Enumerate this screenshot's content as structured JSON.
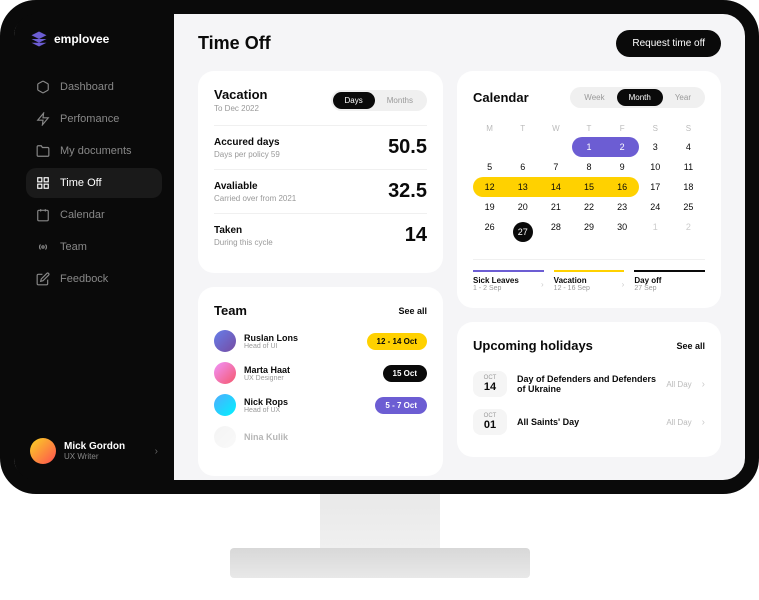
{
  "brand": {
    "name": "emplovee"
  },
  "nav": {
    "items": [
      {
        "label": "Dashboard"
      },
      {
        "label": "Perfomance"
      },
      {
        "label": "My documents"
      },
      {
        "label": "Time Off"
      },
      {
        "label": "Calendar"
      },
      {
        "label": "Team"
      },
      {
        "label": "Feedbock"
      }
    ]
  },
  "user": {
    "name": "Mick Gordon",
    "role": "UX Writer"
  },
  "page": {
    "title": "Time Off",
    "cta": "Request time off"
  },
  "vacation": {
    "title": "Vacation",
    "subtitle": "To Dec 2022",
    "tabs": {
      "days": "Days",
      "months": "Months"
    },
    "stats": [
      {
        "label": "Accured days",
        "sub": "Days per policy 59",
        "value": "50.5"
      },
      {
        "label": "Avaliable",
        "sub": "Carried over from 2021",
        "value": "32.5"
      },
      {
        "label": "Taken",
        "sub": "During this cycle",
        "value": "14"
      }
    ]
  },
  "team": {
    "title": "Team",
    "see_all": "See all",
    "members": [
      {
        "name": "Ruslan Lons",
        "role": "Head of UI",
        "badge": "12 - 14 Oct",
        "badge_style": "yellow"
      },
      {
        "name": "Marta Haat",
        "role": "UX Designer",
        "badge": "15 Oct",
        "badge_style": "black"
      },
      {
        "name": "Nick Rops",
        "role": "Head of UX",
        "badge": "5 - 7 Oct",
        "badge_style": "purple"
      },
      {
        "name": "Nina Kulik",
        "role": "",
        "badge": "",
        "badge_style": ""
      }
    ]
  },
  "calendar": {
    "title": "Calendar",
    "tabs": {
      "week": "Week",
      "month": "Month",
      "year": "Year"
    },
    "headers": [
      "M",
      "T",
      "W",
      "T",
      "F",
      "S",
      "S"
    ],
    "legend": [
      {
        "name": "Sick Leaves",
        "date": "1 - 2 Sep",
        "bar": "p"
      },
      {
        "name": "Vacation",
        "date": "12 - 16 Sep",
        "bar": "y"
      },
      {
        "name": "Day off",
        "date": "27 Sep",
        "bar": "b"
      }
    ]
  },
  "holidays": {
    "title": "Upcoming holidays",
    "see_all": "See all",
    "items": [
      {
        "month": "OCT",
        "day": "14",
        "name": "Day of Defenders and Defenders of Ukraine",
        "time": "All Day"
      },
      {
        "month": "OCT",
        "day": "01",
        "name": "All Saints' Day",
        "time": "All Day"
      }
    ]
  }
}
